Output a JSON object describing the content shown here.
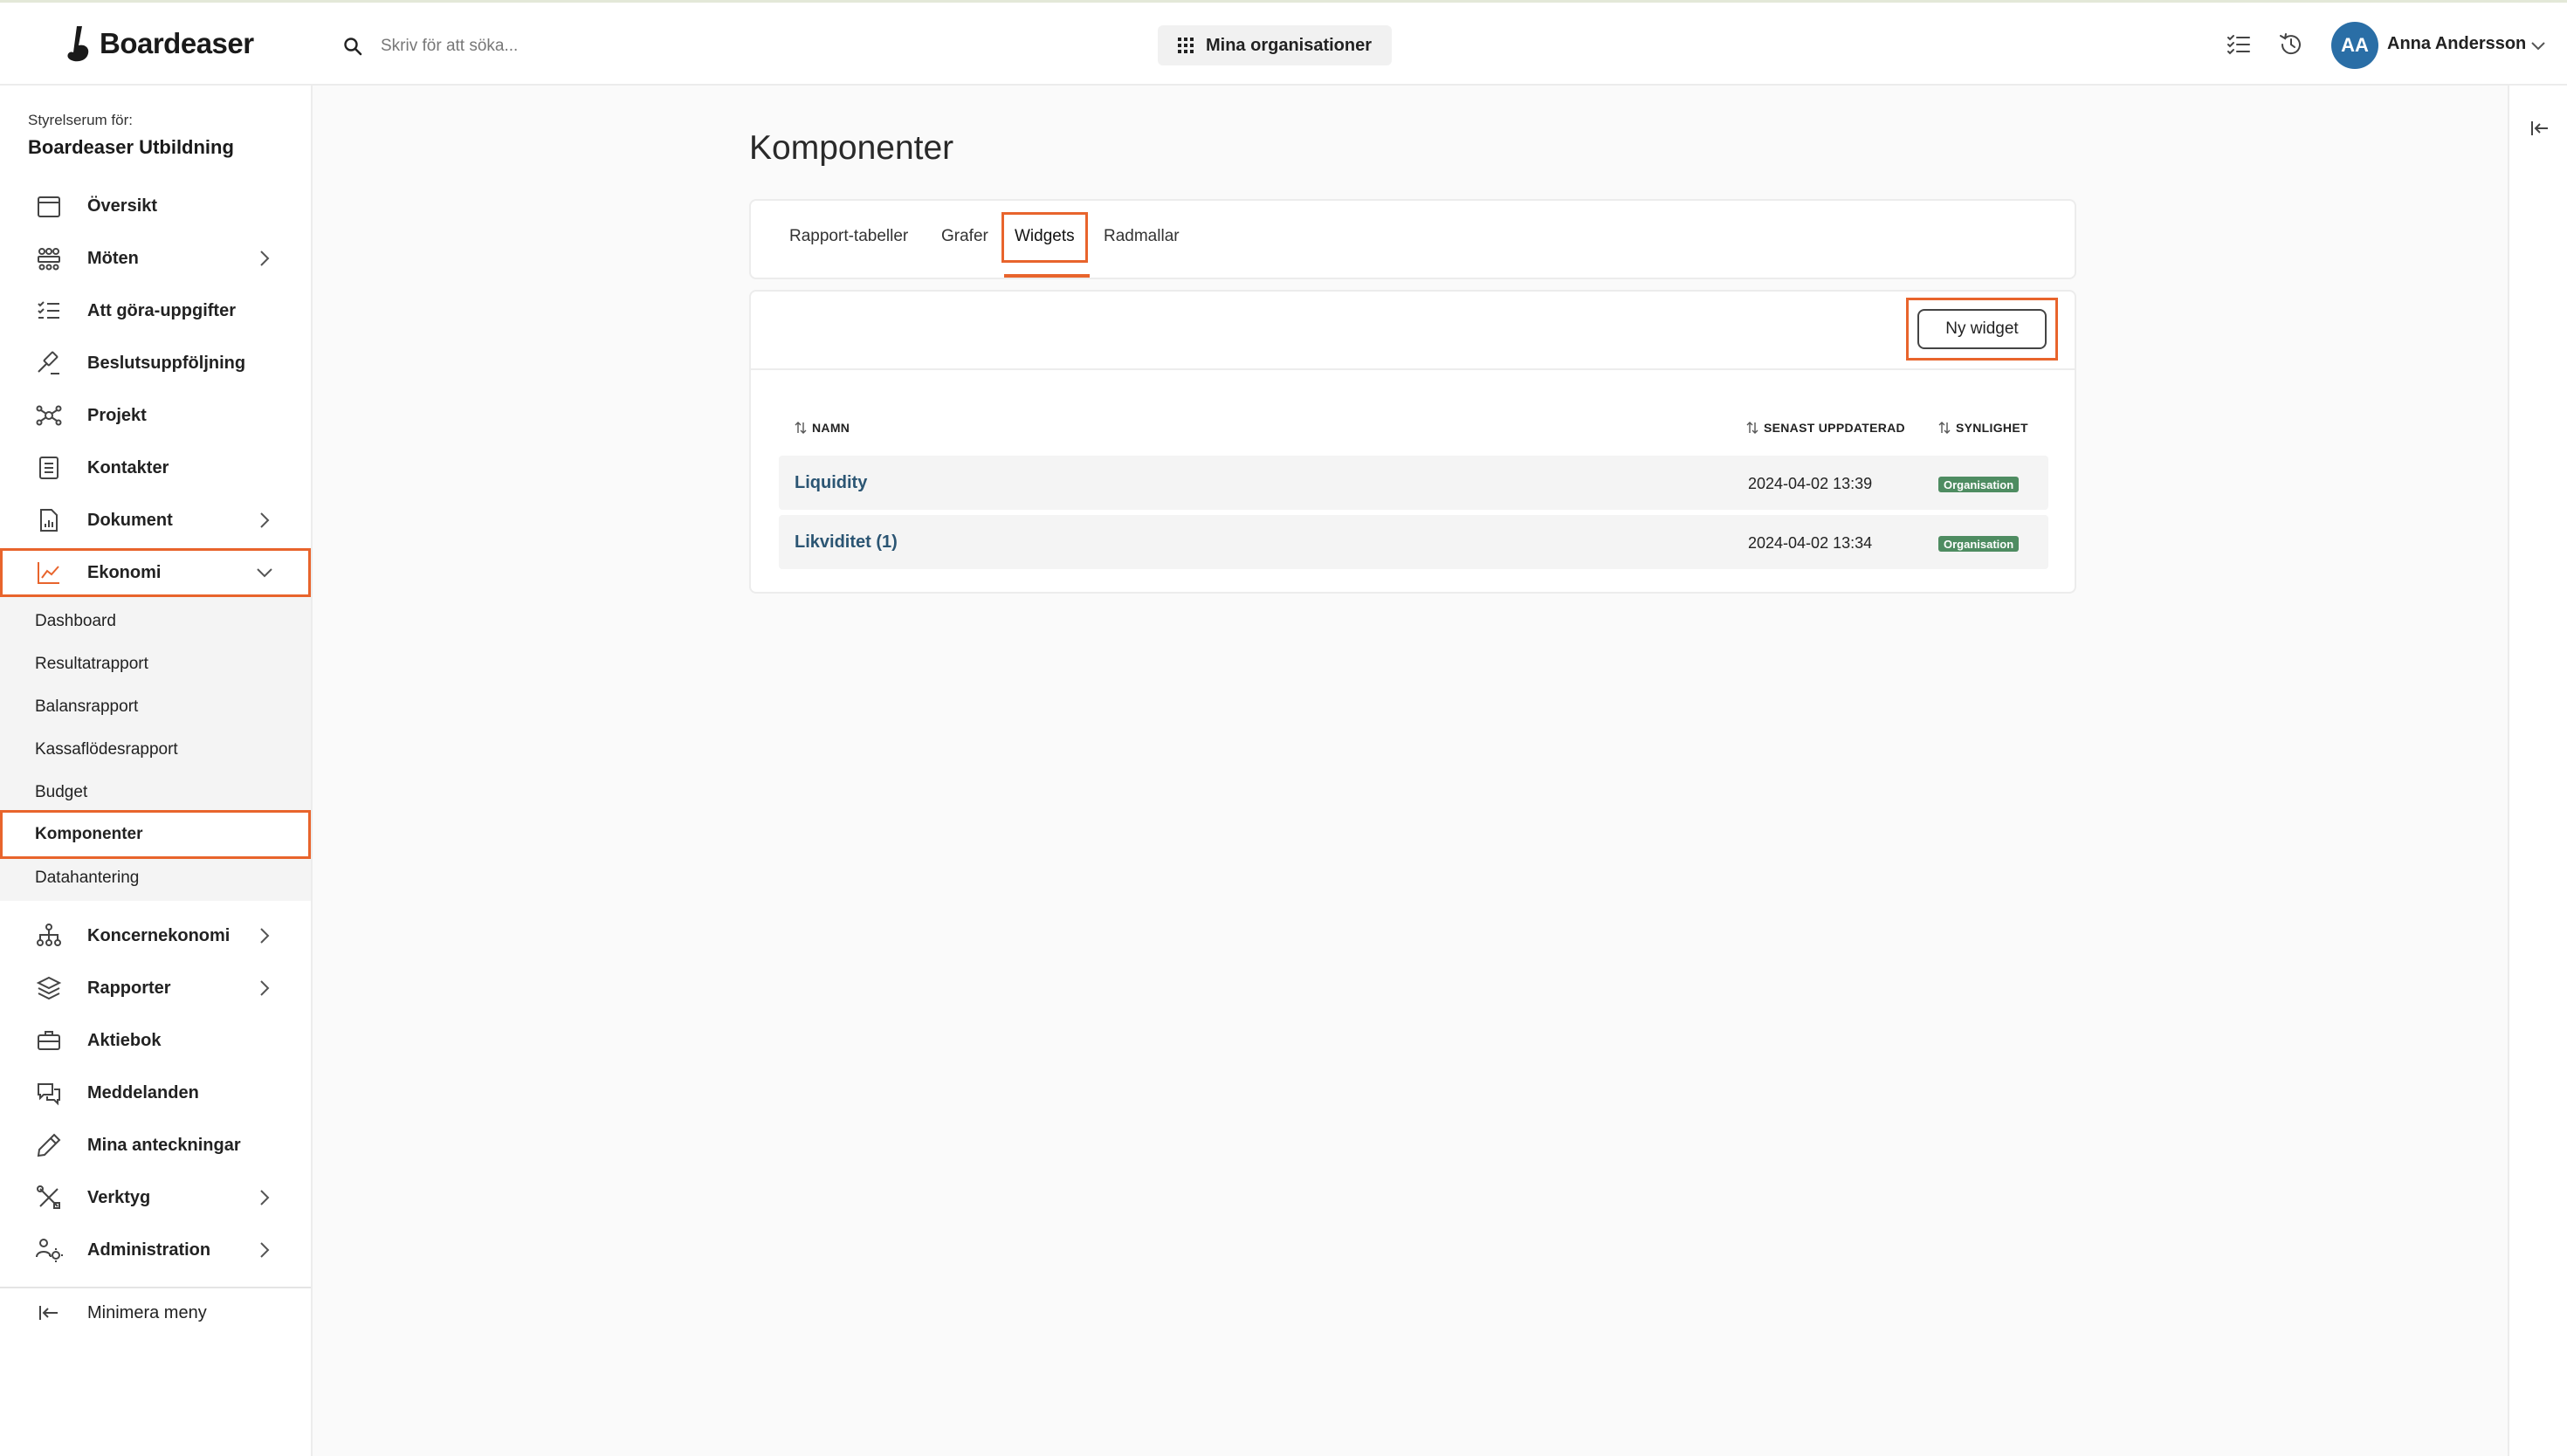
{
  "app": {
    "logo_text": "Boardeaser"
  },
  "topbar": {
    "search_placeholder": "Skriv för att söka...",
    "orgs_button": "Mina organisationer",
    "user": {
      "initials": "AA",
      "name": "Anna Andersson",
      "avatar_color": "#2a6ea6"
    }
  },
  "sidebar": {
    "subtitle": "Styrelserum för:",
    "org_name": "Boardeaser Utbildning",
    "items": [
      {
        "label": "Översikt",
        "icon": "calendar-icon"
      },
      {
        "label": "Möten",
        "icon": "meeting-icon",
        "expandable": true
      },
      {
        "label": "Att göra-uppgifter",
        "icon": "checklist-icon"
      },
      {
        "label": "Beslutsuppföljning",
        "icon": "gavel-icon"
      },
      {
        "label": "Projekt",
        "icon": "network-icon"
      },
      {
        "label": "Kontakter",
        "icon": "contacts-icon"
      },
      {
        "label": "Dokument",
        "icon": "document-icon",
        "expandable": true
      },
      {
        "label": "Ekonomi",
        "icon": "chart-line-icon",
        "expanded": true
      },
      {
        "label": "Koncernekonomi",
        "icon": "hierarchy-icon",
        "expandable": true
      },
      {
        "label": "Rapporter",
        "icon": "layers-icon",
        "expandable": true
      },
      {
        "label": "Aktiebok",
        "icon": "briefcase-icon"
      },
      {
        "label": "Meddelanden",
        "icon": "chat-icon"
      },
      {
        "label": "Mina anteckningar",
        "icon": "pencil-icon"
      },
      {
        "label": "Verktyg",
        "icon": "tools-icon",
        "expandable": true
      },
      {
        "label": "Administration",
        "icon": "users-gear-icon",
        "expandable": true
      }
    ],
    "ekonomi_sub": [
      {
        "label": "Dashboard"
      },
      {
        "label": "Resultatrapport"
      },
      {
        "label": "Balansrapport"
      },
      {
        "label": "Kassaflödesrapport"
      },
      {
        "label": "Budget"
      },
      {
        "label": "Komponenter",
        "active": true
      },
      {
        "label": "Datahantering"
      }
    ],
    "minimize_label": "Minimera meny"
  },
  "main": {
    "title": "Komponenter",
    "tabs": [
      {
        "label": "Rapport-tabeller"
      },
      {
        "label": "Grafer"
      },
      {
        "label": "Widgets",
        "active": true
      },
      {
        "label": "Radmallar"
      }
    ],
    "new_button": "Ny widget",
    "table": {
      "headers": [
        "NAMN",
        "SENAST UPPDATERAD",
        "SYNLIGHET"
      ],
      "rows": [
        {
          "name": "Liquidity",
          "updated": "2024-04-02 13:39",
          "visibility": "Organisation"
        },
        {
          "name": "Likviditet (1)",
          "updated": "2024-04-02 13:34",
          "visibility": "Organisation"
        }
      ]
    }
  },
  "colors": {
    "highlight": "#e8642c",
    "badge_green": "#4e8c61",
    "link_blue": "#2b5573"
  }
}
